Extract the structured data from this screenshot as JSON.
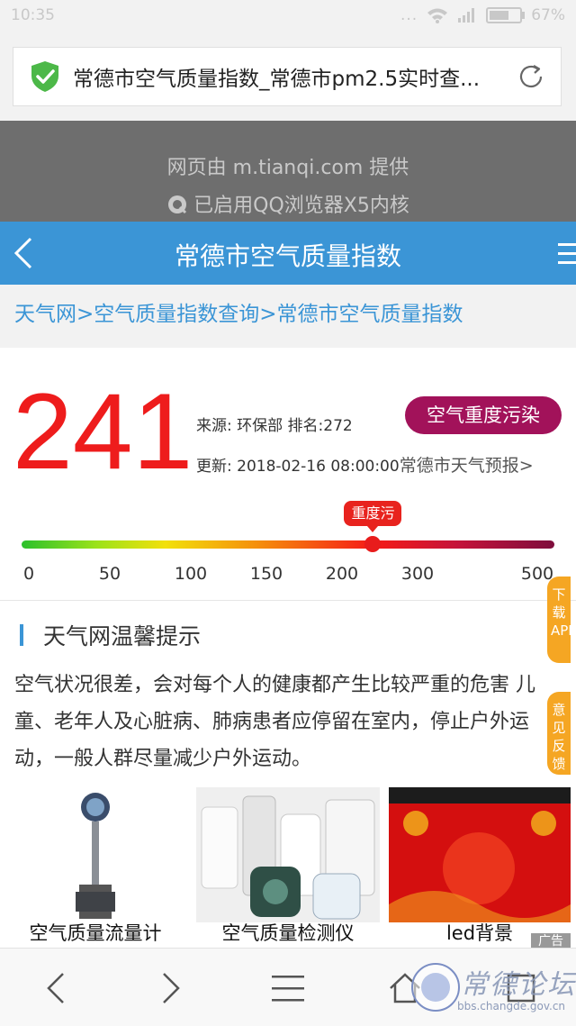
{
  "status_bar": {
    "time": "10:35",
    "dots": "...",
    "battery_percent": "67%",
    "battery_level": 0.67
  },
  "address_bar": {
    "title": "常德市空气质量指数_常德市pm2.5实时查..."
  },
  "provider_banner": {
    "line1": "网页由 m.tianqi.com 提供",
    "line2": "已启用QQ浏览器X5内核"
  },
  "header": {
    "title": "常德市空气质量指数"
  },
  "breadcrumb": "天气网>空气质量指数查询>常德市空气质量指数",
  "aqi": {
    "value": "241",
    "source": "来源: 环保部  排名:272",
    "updated": "更新: 2018-02-16 08:00:00",
    "forecast_link": "常德市天气预报>",
    "level": "空气重度污染",
    "indicator_label": "重度污",
    "scale_labels": [
      "0",
      "50",
      "100",
      "150",
      "200",
      "300",
      "500"
    ]
  },
  "tips": {
    "title": "天气网温馨提示",
    "body": "空气状况很差，会对每个人的健康都产生比较严重的危害 儿童、老年人及心脏病、肺病患者应停留在室内，停止户外运动，一般人群尽量减少户外运动。"
  },
  "side_tabs": {
    "download": "下载APP",
    "feedback": "意见反馈"
  },
  "ads": [
    {
      "caption": "空气质量流量计"
    },
    {
      "caption": "空气质量检测仪"
    },
    {
      "caption": "led背景"
    }
  ],
  "ad_label": "广告",
  "watermark": {
    "text": "常德论坛",
    "url": "bbs.changde.gov.cn"
  },
  "colors": {
    "accent": "#3b95d6",
    "aqi_red": "#ee1c1c",
    "badge": "#a2125a",
    "side_tab": "#f5a623"
  }
}
